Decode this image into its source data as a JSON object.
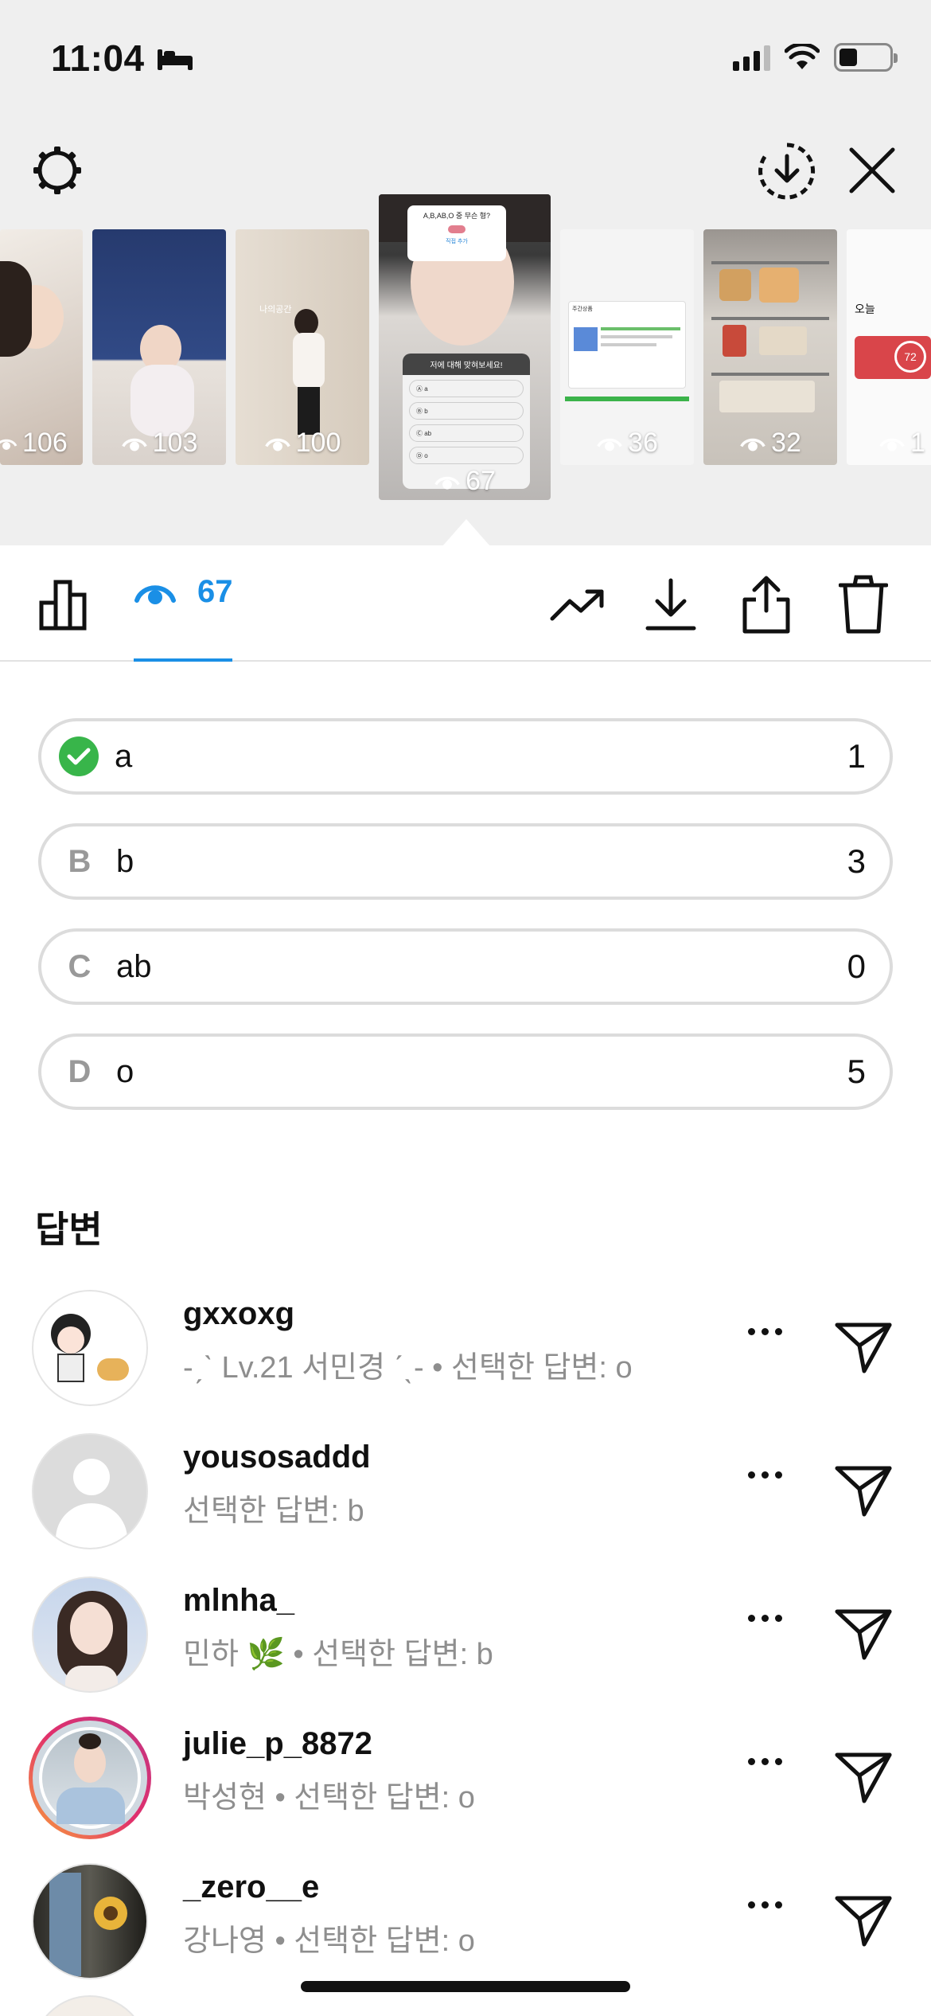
{
  "status_bar": {
    "time": "11:04"
  },
  "thumbnails": [
    {
      "views": "106"
    },
    {
      "views": "103"
    },
    {
      "views": "100",
      "caption": "나의공간"
    },
    {
      "views": "67",
      "question": "A,B,AB,O 중 무슨 형?",
      "quiz_title": "저에 대해 맞혀보세요!",
      "options": [
        "a",
        "b",
        "ab",
        "o"
      ],
      "reply_label": "직접 추가"
    },
    {
      "views": "36",
      "caption": "주간상품"
    },
    {
      "views": "32"
    },
    {
      "views": "1",
      "caption": "오늘",
      "gauge": "72"
    }
  ],
  "toolbar": {
    "views_count": "67"
  },
  "quiz": {
    "options": [
      {
        "letter": "",
        "text": "a",
        "count": "1",
        "correct": true
      },
      {
        "letter": "B",
        "text": "b",
        "count": "3",
        "correct": false
      },
      {
        "letter": "C",
        "text": "ab",
        "count": "0",
        "correct": false
      },
      {
        "letter": "D",
        "text": "o",
        "count": "5",
        "correct": false
      }
    ]
  },
  "answers_title": "답변",
  "answers": [
    {
      "username": "gxxoxg",
      "subtitle": "-ˏˋ Lv.21 서민경 ˊˎ- • 선택한 답변: o"
    },
    {
      "username": "yousosaddd",
      "subtitle": "선택한 답변: b"
    },
    {
      "username": "mlnha_",
      "subtitle": "민하 🌿 • 선택한 답변: b"
    },
    {
      "username": "julie_p_8872",
      "subtitle": "박성현 • 선택한 답변: o"
    },
    {
      "username": "_zero__e",
      "subtitle": "강나영 • 선택한 답변: o"
    }
  ],
  "colors": {
    "accent": "#1a8fe6",
    "correct": "#38b54a",
    "muted": "#8e8e8e"
  }
}
